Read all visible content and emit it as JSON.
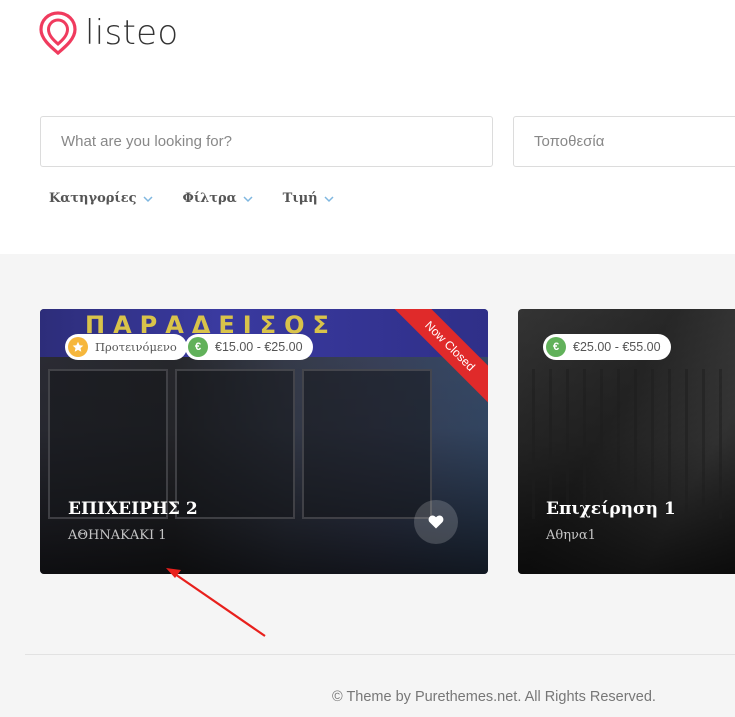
{
  "header": {
    "logo_text": "listeo",
    "accent": "#f03b5e"
  },
  "search": {
    "what_placeholder": "What are you looking for?",
    "where_placeholder": "Τοποθεσία"
  },
  "filters": {
    "categories": "Κατηγορίες",
    "filters": "Φίλτρα",
    "price": "Τιμή"
  },
  "listings": [
    {
      "sign_text": "ΠΑΡΑΔΕΙΣΟΣ",
      "featured_label": "Προτεινόμενο",
      "price_range": "€15.00 - €25.00",
      "status": "Now Closed",
      "title": "ΕΠΙΧΕΙΡΗΣ 2",
      "address": "ΑΘΗΝΑΚΑΚΙ 1"
    },
    {
      "price_range": "€25.00 - €55.00",
      "title": "Επιχείρηση 1",
      "address": "Αθηνα1"
    }
  ],
  "footer": {
    "copyright": "© Theme by Purethemes.net. All Rights Reserved."
  },
  "colors": {
    "ribbon": "#e02a2a",
    "euro_badge": "#61b15a",
    "star_badge": "#f6b73c",
    "annotation_arrow": "#e8201c"
  }
}
